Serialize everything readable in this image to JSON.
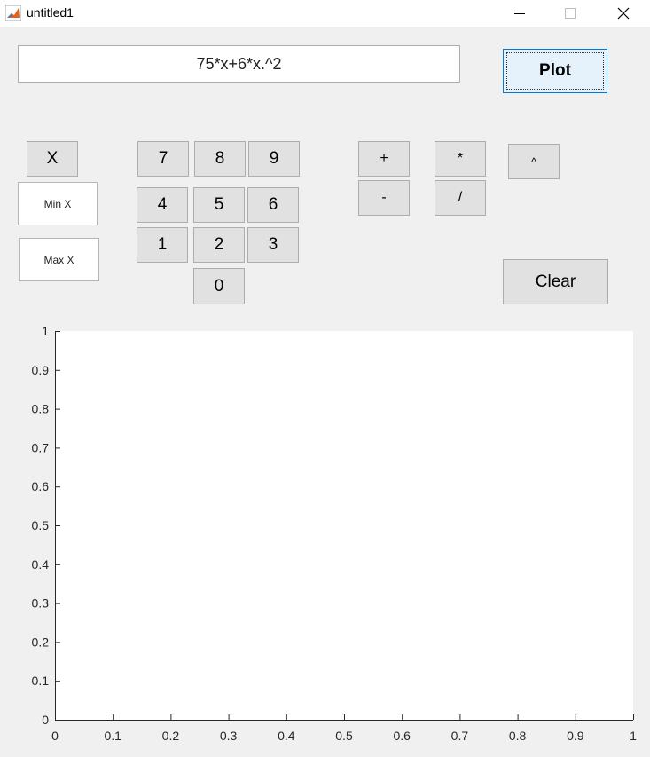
{
  "window": {
    "title": "untitled1",
    "controls": {
      "minimize": "–",
      "maximize": "□",
      "close": "✕"
    }
  },
  "expression": "75*x+6*x.^2",
  "buttons": {
    "plot": "Plot",
    "x": "X",
    "digits": {
      "d7": "7",
      "d8": "8",
      "d9": "9",
      "d4": "4",
      "d5": "5",
      "d6": "6",
      "d1": "1",
      "d2": "2",
      "d3": "3",
      "d0": "0"
    },
    "ops": {
      "plus": "+",
      "minus": "-",
      "times": "*",
      "divide": "/",
      "power": "^"
    },
    "clear": "Clear"
  },
  "fields": {
    "min_x": "Min X",
    "max_x": "Max X"
  },
  "chart_data": {
    "type": "line",
    "title": "",
    "xlabel": "",
    "ylabel": "",
    "xlim": [
      0,
      1
    ],
    "ylim": [
      0,
      1
    ],
    "xticks": [
      "0",
      "0.1",
      "0.2",
      "0.3",
      "0.4",
      "0.5",
      "0.6",
      "0.7",
      "0.8",
      "0.9",
      "1"
    ],
    "yticks": [
      "0",
      "0.1",
      "0.2",
      "0.3",
      "0.4",
      "0.5",
      "0.6",
      "0.7",
      "0.8",
      "0.9",
      "1"
    ],
    "series": [],
    "grid": false,
    "colors": {
      "axis": "#262626",
      "background": "#ffffff"
    }
  }
}
